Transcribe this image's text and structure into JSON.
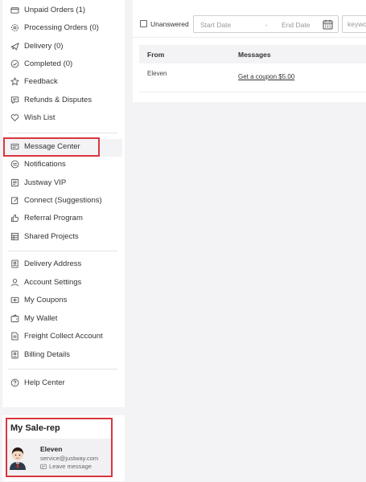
{
  "sidebar": {
    "items": [
      {
        "label": "Unpaid Orders (1)",
        "icon": "wallet-icon"
      },
      {
        "label": "Processing Orders (0)",
        "icon": "gear-icon"
      },
      {
        "label": "Delivery (0)",
        "icon": "plane-icon"
      },
      {
        "label": "Completed (0)",
        "icon": "check-circle-icon"
      },
      {
        "label": "Feedback",
        "icon": "star-icon"
      },
      {
        "label": "Refunds & Disputes",
        "icon": "chat-bubble-icon"
      },
      {
        "label": "Wish List",
        "icon": "heart-icon"
      },
      {
        "label": "Message Center",
        "icon": "envelope-icon"
      },
      {
        "label": "Notifications",
        "icon": "bell-icon"
      },
      {
        "label": "Justway VIP",
        "icon": "vip-icon"
      },
      {
        "label": "Connect (Suggestions)",
        "icon": "edit-icon"
      },
      {
        "label": "Referral Program",
        "icon": "thumbs-up-icon"
      },
      {
        "label": "Shared Projects",
        "icon": "grid-icon"
      },
      {
        "label": "Delivery Address",
        "icon": "address-card-icon"
      },
      {
        "label": "Account Settings",
        "icon": "user-icon"
      },
      {
        "label": "My Coupons",
        "icon": "coupon-icon"
      },
      {
        "label": "My Wallet",
        "icon": "wallet-icon"
      },
      {
        "label": "Freight Collect Account",
        "icon": "document-icon"
      },
      {
        "label": "Billing Details",
        "icon": "bill-icon"
      },
      {
        "label": "Help Center",
        "icon": "question-circle-icon"
      }
    ]
  },
  "salerep": {
    "title": "My Sale-rep",
    "name": "Eleven",
    "email": "service@justway.com",
    "leave_message": "Leave message"
  },
  "filters": {
    "unanswered_label": "Unanswered",
    "start_date_placeholder": "Start Date",
    "separator": "-",
    "end_date_placeholder": "End Date",
    "keyword_placeholder": "keywo"
  },
  "table": {
    "columns": [
      "From",
      "Messages"
    ],
    "rows": [
      {
        "from": "Eleven",
        "message": "Get a coupon $5.00"
      }
    ]
  },
  "colors": {
    "highlight": "#d9363e",
    "background": "#f3f3f5"
  }
}
